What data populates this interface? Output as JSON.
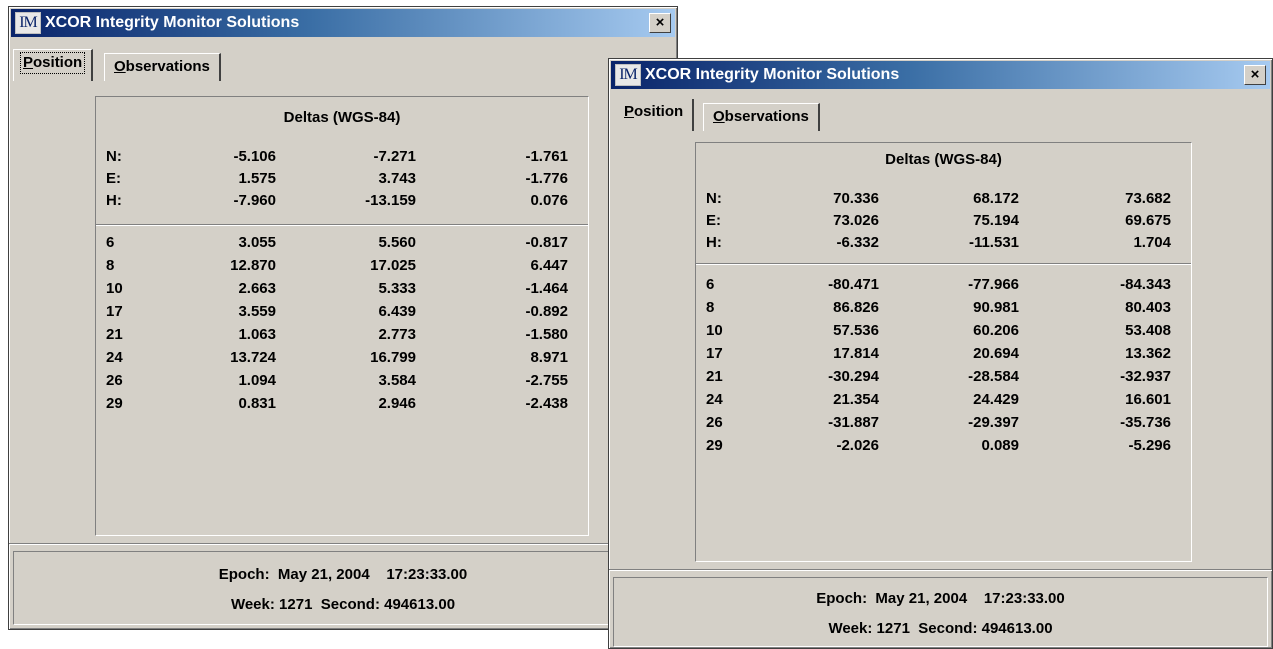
{
  "windows": [
    {
      "title": "XCOR Integrity Monitor Solutions",
      "icon_text": "IM",
      "close_glyph": "×",
      "tabs": [
        {
          "accel": "P",
          "rest": "osition",
          "active": true
        },
        {
          "accel": "O",
          "rest": "bservations",
          "active": false
        }
      ],
      "deltas_title": "Deltas (WGS-84)",
      "deltas": [
        {
          "label": "N:",
          "v1": "-5.106",
          "v2": "-7.271",
          "v3": "-1.761"
        },
        {
          "label": "E:",
          "v1": "1.575",
          "v2": "3.743",
          "v3": "-1.776"
        },
        {
          "label": "H:",
          "v1": "-7.960",
          "v2": "-13.159",
          "v3": "0.076"
        }
      ],
      "satellites": [
        {
          "label": "6",
          "v1": "3.055",
          "v2": "5.560",
          "v3": "-0.817"
        },
        {
          "label": "8",
          "v1": "12.870",
          "v2": "17.025",
          "v3": "6.447"
        },
        {
          "label": "10",
          "v1": "2.663",
          "v2": "5.333",
          "v3": "-1.464"
        },
        {
          "label": "17",
          "v1": "3.559",
          "v2": "6.439",
          "v3": "-0.892"
        },
        {
          "label": "21",
          "v1": "1.063",
          "v2": "2.773",
          "v3": "-1.580"
        },
        {
          "label": "24",
          "v1": "13.724",
          "v2": "16.799",
          "v3": "8.971"
        },
        {
          "label": "26",
          "v1": "1.094",
          "v2": "3.584",
          "v3": "-2.755"
        },
        {
          "label": "29",
          "v1": "0.831",
          "v2": "2.946",
          "v3": "-2.438"
        }
      ],
      "footer": {
        "epoch_label": "Epoch:",
        "epoch_date": "May 21, 2004",
        "epoch_time": "17:23:33.00",
        "week_label": "Week:",
        "week_value": "1271",
        "second_label": "Second:",
        "second_value": "494613.00"
      }
    },
    {
      "title": "XCOR Integrity Monitor Solutions",
      "icon_text": "IM",
      "close_glyph": "×",
      "tabs": [
        {
          "accel": "P",
          "rest": "osition",
          "active": true
        },
        {
          "accel": "O",
          "rest": "bservations",
          "active": false
        }
      ],
      "deltas_title": "Deltas (WGS-84)",
      "deltas": [
        {
          "label": "N:",
          "v1": "70.336",
          "v2": "68.172",
          "v3": "73.682"
        },
        {
          "label": "E:",
          "v1": "73.026",
          "v2": "75.194",
          "v3": "69.675"
        },
        {
          "label": "H:",
          "v1": "-6.332",
          "v2": "-11.531",
          "v3": "1.704"
        }
      ],
      "satellites": [
        {
          "label": "6",
          "v1": "-80.471",
          "v2": "-77.966",
          "v3": "-84.343"
        },
        {
          "label": "8",
          "v1": "86.826",
          "v2": "90.981",
          "v3": "80.403"
        },
        {
          "label": "10",
          "v1": "57.536",
          "v2": "60.206",
          "v3": "53.408"
        },
        {
          "label": "17",
          "v1": "17.814",
          "v2": "20.694",
          "v3": "13.362"
        },
        {
          "label": "21",
          "v1": "-30.294",
          "v2": "-28.584",
          "v3": "-32.937"
        },
        {
          "label": "24",
          "v1": "21.354",
          "v2": "24.429",
          "v3": "16.601"
        },
        {
          "label": "26",
          "v1": "-31.887",
          "v2": "-29.397",
          "v3": "-35.736"
        },
        {
          "label": "29",
          "v1": "-2.026",
          "v2": "0.089",
          "v3": "-5.296"
        }
      ],
      "footer": {
        "epoch_label": "Epoch:",
        "epoch_date": "May 21, 2004",
        "epoch_time": "17:23:33.00",
        "week_label": "Week:",
        "week_value": "1271",
        "second_label": "Second:",
        "second_value": "494613.00"
      }
    }
  ]
}
